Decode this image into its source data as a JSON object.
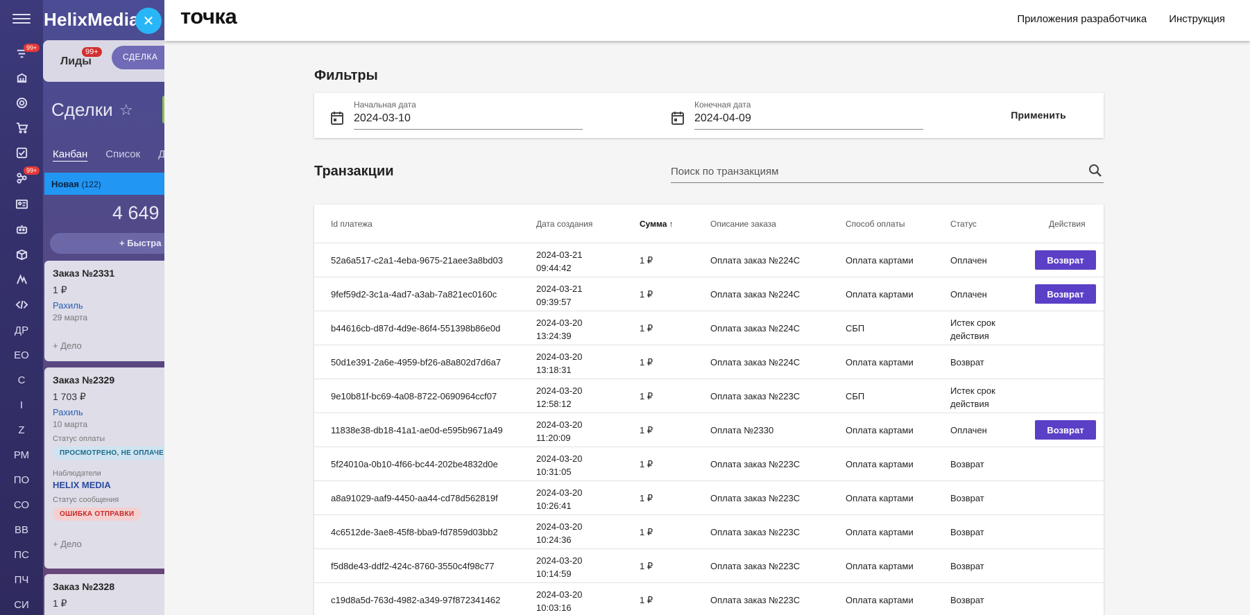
{
  "rail": {
    "badge_filter": "99+",
    "badge_org": "99+",
    "text_items": [
      "ДР",
      "ЕО",
      "С",
      "I",
      "Z",
      "РМ",
      "ПО",
      "СО",
      "ВВ",
      "ПС",
      "ПЧ",
      "СИ"
    ]
  },
  "crm": {
    "brand": "HelixMedia",
    "tab_leads": "Лиды",
    "tab_leads_badge": "99+",
    "tab_deal": "СДЕЛКА",
    "page_title": "Сделки",
    "view_kanban": "Канбан",
    "view_list": "Список",
    "view_more": "Д",
    "column_name": "Новая",
    "column_count": "(122)",
    "column_sum": "4 649",
    "quick_add": "Быстра",
    "cards": [
      {
        "title": "Заказ №2331",
        "sum": "1 ₽",
        "person": "Рахиль",
        "date": "29 марта",
        "add": "+ Дело"
      },
      {
        "title": "Заказ №2329",
        "sum": "1 703 ₽",
        "person": "Рахиль",
        "date": "10 марта",
        "pay_label": "Статус оплаты",
        "pay_chip": "ПРОСМОТРЕНО, НЕ ОПЛАЧЕ",
        "obs_label": "Наблюдатели",
        "observer": "HELIX MEDIA",
        "msg_label": "Статус сообщения",
        "msg_chip": "ОШИБКА ОТПРАВКИ",
        "add": "+ Дело"
      },
      {
        "title": "Заказ №2328",
        "sum": "1 ₽"
      }
    ]
  },
  "header": {
    "logo": "точка",
    "link_dev_apps": "Приложения разработчика",
    "link_instructions": "Инструкция"
  },
  "filters": {
    "title": "Фильтры",
    "start_label": "Начальная дата",
    "start_value": "2024-03-10",
    "end_label": "Конечная дата",
    "end_value": "2024-04-09",
    "apply": "Применить"
  },
  "transactions": {
    "title": "Транзакции",
    "search_placeholder": "Поиск по транзакциям",
    "columns": {
      "id": "Id платежа",
      "created": "Дата создания",
      "amount": "Сумма",
      "description": "Описание заказа",
      "method": "Способ оплаты",
      "status": "Статус",
      "actions": "Действия"
    },
    "refund_label": "Возврат",
    "rows": [
      {
        "id": "52a6a517-c2a1-4eba-9675-21aee3a8bd03",
        "date": "2024-03-21",
        "time": "09:44:42",
        "amount": "1 ₽",
        "desc": "Оплата заказ №224С",
        "method": "Оплата картами",
        "status": "Оплачен",
        "status2": "",
        "refund": true
      },
      {
        "id": "9fef59d2-3c1a-4ad7-a3ab-7a821ec0160c",
        "date": "2024-03-21",
        "time": "09:39:57",
        "amount": "1 ₽",
        "desc": "Оплата заказ №224С",
        "method": "Оплата картами",
        "status": "Оплачен",
        "status2": "",
        "refund": true
      },
      {
        "id": "b44616cb-d87d-4d9e-86f4-551398b86e0d",
        "date": "2024-03-20",
        "time": "13:24:39",
        "amount": "1 ₽",
        "desc": "Оплата заказ №224С",
        "method": "СБП",
        "status": "Истек срок",
        "status2": "действия",
        "refund": false
      },
      {
        "id": "50d1e391-2a6e-4959-bf26-a8a802d7d6a7",
        "date": "2024-03-20",
        "time": "13:18:31",
        "amount": "1 ₽",
        "desc": "Оплата заказ №224С",
        "method": "Оплата картами",
        "status": "Возврат",
        "status2": "",
        "refund": false
      },
      {
        "id": "9e10b81f-bc69-4a08-8722-0690964ccf07",
        "date": "2024-03-20",
        "time": "12:58:12",
        "amount": "1 ₽",
        "desc": "Оплата заказ №223С",
        "method": "СБП",
        "status": "Истек срок",
        "status2": "действия",
        "refund": false
      },
      {
        "id": "11838e38-db18-41a1-ae0d-e595b9671a49",
        "date": "2024-03-20",
        "time": "11:20:09",
        "amount": "1 ₽",
        "desc": "Оплата №2330",
        "method": "Оплата картами",
        "status": "Оплачен",
        "status2": "",
        "refund": true
      },
      {
        "id": "5f24010a-0b10-4f66-bc44-202be4832d0e",
        "date": "2024-03-20",
        "time": "10:31:05",
        "amount": "1 ₽",
        "desc": "Оплата заказ №223С",
        "method": "Оплата картами",
        "status": "Возврат",
        "status2": "",
        "refund": false
      },
      {
        "id": "a8a91029-aaf9-4450-aa44-cd78d562819f",
        "date": "2024-03-20",
        "time": "10:26:41",
        "amount": "1 ₽",
        "desc": "Оплата заказ №223С",
        "method": "Оплата картами",
        "status": "Возврат",
        "status2": "",
        "refund": false
      },
      {
        "id": "4c6512de-3ae8-45f8-bba9-fd7859d03bb2",
        "date": "2024-03-20",
        "time": "10:24:36",
        "amount": "1 ₽",
        "desc": "Оплата заказ №223С",
        "method": "Оплата картами",
        "status": "Возврат",
        "status2": "",
        "refund": false
      },
      {
        "id": "f5d8de43-ddf2-424c-8760-3550c4f98c77",
        "date": "2024-03-20",
        "time": "10:14:59",
        "amount": "1 ₽",
        "desc": "Оплата заказ №223С",
        "method": "Оплата картами",
        "status": "Возврат",
        "status2": "",
        "refund": false
      },
      {
        "id": "c19d8a5d-763d-4982-a349-97f872341462",
        "date": "2024-03-20",
        "time": "10:03:16",
        "amount": "1 ₽",
        "desc": "Оплата заказ №223С",
        "method": "Оплата картами",
        "status": "Возврат",
        "status2": "",
        "refund": false
      }
    ]
  },
  "colors": {
    "accent": "#5b3fc6",
    "close_fab": "#29b6f6",
    "column_head": "#2196f3"
  }
}
